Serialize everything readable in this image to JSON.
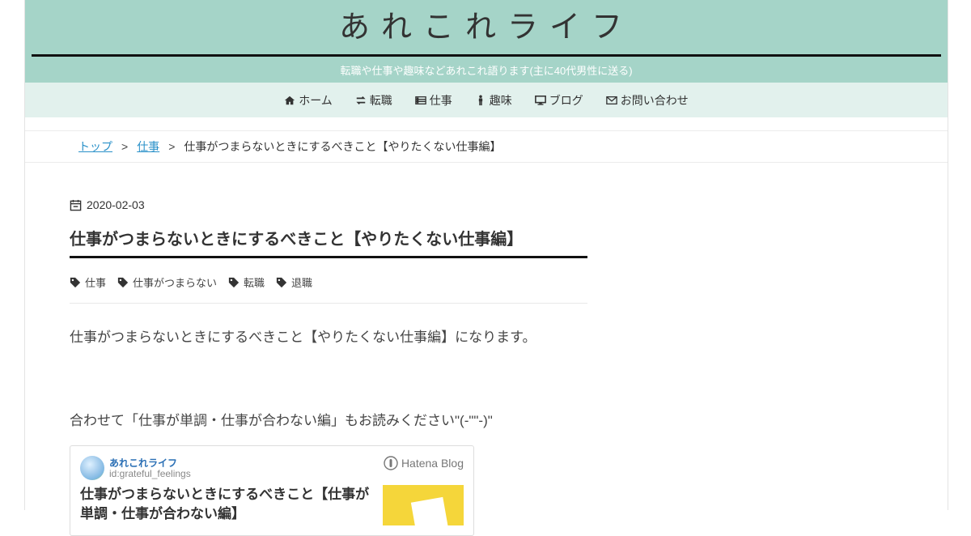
{
  "site": {
    "title": "あれこれライフ",
    "tagline": "転職や仕事や趣味などあれこれ語ります(主に40代男性に送る)"
  },
  "nav": {
    "items": [
      {
        "label": "ホーム",
        "icon": "home-icon"
      },
      {
        "label": "転職",
        "icon": "exchange-icon"
      },
      {
        "label": "仕事",
        "icon": "list-icon"
      },
      {
        "label": "趣味",
        "icon": "person-icon"
      },
      {
        "label": "ブログ",
        "icon": "desktop-icon"
      },
      {
        "label": "お問い合わせ",
        "icon": "envelope-icon"
      }
    ]
  },
  "breadcrumb": {
    "top": "トップ",
    "category": "仕事",
    "current": "仕事がつまらないときにするべきこと【やりたくない仕事編】",
    "separator": ">"
  },
  "article": {
    "date": "2020-02-03",
    "title": "仕事がつまらないときにするべきこと【やりたくない仕事編】",
    "tags": [
      "仕事",
      "仕事がつまらない",
      "転職",
      "退職"
    ],
    "paragraph1": "仕事がつまらないときにするべきこと【やりたくない仕事編】になります。",
    "paragraph2": "合わせて「仕事が単調・仕事が合わない編」もお読みください\"(-\"\"-)\""
  },
  "embed": {
    "blog_name": "あれこれライフ",
    "user_id": "id:grateful_feelings",
    "brand": "Hatena Blog",
    "title": "仕事がつまらないときにするべきこと【仕事が単調・仕事が合わない編】"
  },
  "colors": {
    "header_bg": "#a5d4c8",
    "nav_bg": "#e2f1ed",
    "link": "#2a91c9"
  }
}
